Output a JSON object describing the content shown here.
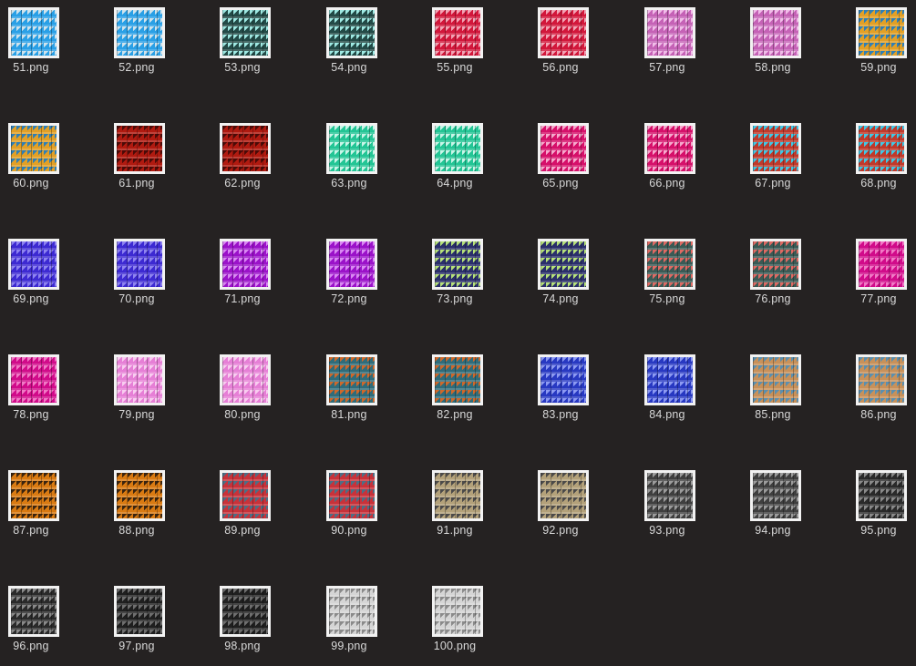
{
  "files": [
    {
      "name": "51.png",
      "c1": "#2aa0e6",
      "c2": "#cfe3ec"
    },
    {
      "name": "52.png",
      "c1": "#2aa0e6",
      "c2": "#cfe3ec"
    },
    {
      "name": "53.png",
      "c1": "#234a47",
      "c2": "#9fe9e3"
    },
    {
      "name": "54.png",
      "c1": "#234a47",
      "c2": "#9fe9e3"
    },
    {
      "name": "55.png",
      "c1": "#d2173b",
      "c2": "#f2a4b5"
    },
    {
      "name": "56.png",
      "c1": "#d2173b",
      "c2": "#f2a4b5"
    },
    {
      "name": "57.png",
      "c1": "#c562b6",
      "c2": "#f0bde8"
    },
    {
      "name": "58.png",
      "c1": "#c562b6",
      "c2": "#f0bde8"
    },
    {
      "name": "59.png",
      "c1": "#e2a026",
      "c2": "#2d7fb8"
    },
    {
      "name": "60.png",
      "c1": "#e2a026",
      "c2": "#2d7fb8"
    },
    {
      "name": "61.png",
      "c1": "#b01a10",
      "c2": "#4a0b08"
    },
    {
      "name": "62.png",
      "c1": "#b01a10",
      "c2": "#4a0b08"
    },
    {
      "name": "63.png",
      "c1": "#23c595",
      "c2": "#c9f5e8"
    },
    {
      "name": "64.png",
      "c1": "#23c595",
      "c2": "#c9f5e8"
    },
    {
      "name": "65.png",
      "c1": "#d6106a",
      "c2": "#f6a9cd"
    },
    {
      "name": "66.png",
      "c1": "#d6106a",
      "c2": "#f6a9cd"
    },
    {
      "name": "67.png",
      "c1": "#c0392b",
      "c2": "#3fc8e6"
    },
    {
      "name": "68.png",
      "c1": "#c0392b",
      "c2": "#3fc8e6"
    },
    {
      "name": "69.png",
      "c1": "#3d2ad2",
      "c2": "#8f84f0"
    },
    {
      "name": "70.png",
      "c1": "#3d2ad2",
      "c2": "#8f84f0"
    },
    {
      "name": "71.png",
      "c1": "#9b12c9",
      "c2": "#d98af2"
    },
    {
      "name": "72.png",
      "c1": "#9b12c9",
      "c2": "#d98af2"
    },
    {
      "name": "73.png",
      "c1": "#2b2f6b",
      "c2": "#b7e27a"
    },
    {
      "name": "74.png",
      "c1": "#2b2f6b",
      "c2": "#b7e27a"
    },
    {
      "name": "75.png",
      "c1": "#3a5a55",
      "c2": "#e06a63"
    },
    {
      "name": "76.png",
      "c1": "#3a5a55",
      "c2": "#e06a63"
    },
    {
      "name": "77.png",
      "c1": "#d10b8a",
      "c2": "#f17ac6"
    },
    {
      "name": "78.png",
      "c1": "#d10b8a",
      "c2": "#f17ac6"
    },
    {
      "name": "79.png",
      "c1": "#e67fd6",
      "c2": "#f8cdf0"
    },
    {
      "name": "80.png",
      "c1": "#e67fd6",
      "c2": "#f8cdf0"
    },
    {
      "name": "81.png",
      "c1": "#2f6c7a",
      "c2": "#d0682a"
    },
    {
      "name": "82.png",
      "c1": "#2f6c7a",
      "c2": "#d0682a"
    },
    {
      "name": "83.png",
      "c1": "#2839c2",
      "c2": "#8d9af2"
    },
    {
      "name": "84.png",
      "c1": "#2839c2",
      "c2": "#8d9af2"
    },
    {
      "name": "85.png",
      "c1": "#c8915a",
      "c2": "#5a8fb0"
    },
    {
      "name": "86.png",
      "c1": "#c8915a",
      "c2": "#5a8fb0"
    },
    {
      "name": "87.png",
      "c1": "#d97a12",
      "c2": "#3a2410"
    },
    {
      "name": "88.png",
      "c1": "#d97a12",
      "c2": "#3a2410"
    },
    {
      "name": "89.png",
      "c1": "#c8323a",
      "c2": "#4c6f86"
    },
    {
      "name": "90.png",
      "c1": "#c8323a",
      "c2": "#4c6f86"
    },
    {
      "name": "91.png",
      "c1": "#b3a17a",
      "c2": "#4b4a4a"
    },
    {
      "name": "92.png",
      "c1": "#b3a17a",
      "c2": "#4b4a4a"
    },
    {
      "name": "93.png",
      "c1": "#3f3f3f",
      "c2": "#9c9c9c"
    },
    {
      "name": "94.png",
      "c1": "#3f3f3f",
      "c2": "#9c9c9c"
    },
    {
      "name": "95.png",
      "c1": "#2a2a2a",
      "c2": "#8a8a8a"
    },
    {
      "name": "96.png",
      "c1": "#2a2a2a",
      "c2": "#8a8a8a"
    },
    {
      "name": "97.png",
      "c1": "#1f1f1f",
      "c2": "#6f6f6f"
    },
    {
      "name": "98.png",
      "c1": "#1f1f1f",
      "c2": "#6f6f6f"
    },
    {
      "name": "99.png",
      "c1": "#d5d5d5",
      "c2": "#8a8a8a"
    },
    {
      "name": "100.png",
      "c1": "#d5d5d5",
      "c2": "#8a8a8a"
    }
  ]
}
